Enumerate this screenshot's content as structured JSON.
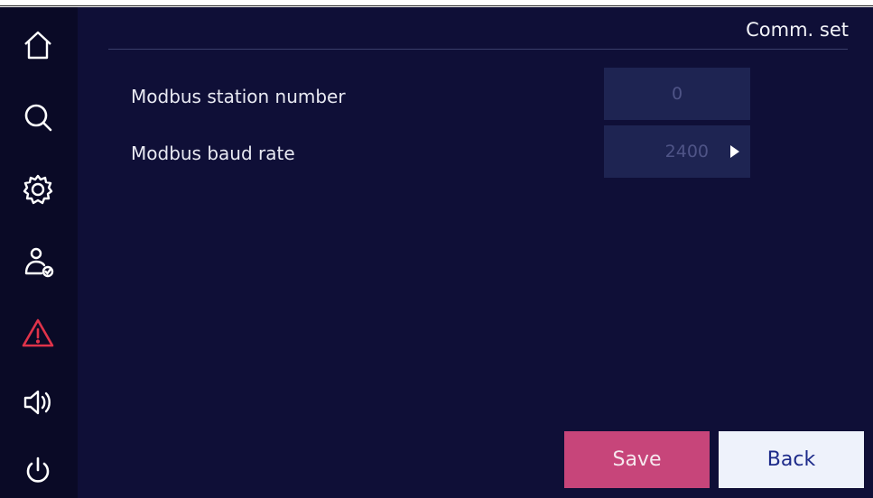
{
  "header": {
    "title": "Comm. set"
  },
  "sidebar": {
    "items": [
      {
        "icon": "home-icon"
      },
      {
        "icon": "search-icon"
      },
      {
        "icon": "gear-icon"
      },
      {
        "icon": "user-check-icon"
      },
      {
        "icon": "alarm-warning-icon",
        "color": "#e0334a"
      },
      {
        "icon": "speaker-icon"
      },
      {
        "icon": "power-icon"
      }
    ]
  },
  "settings": {
    "station": {
      "label": "Modbus station number",
      "value": "0"
    },
    "baud": {
      "label": "Modbus baud rate",
      "value": "2400"
    }
  },
  "buttons": {
    "save": "Save",
    "back": "Back"
  },
  "colors": {
    "background": "#0f0f37",
    "sidebar": "#0a0a26",
    "field": "#1e2452",
    "save": "#c7457a",
    "back": "#eef2fb",
    "warning": "#e0334a"
  }
}
